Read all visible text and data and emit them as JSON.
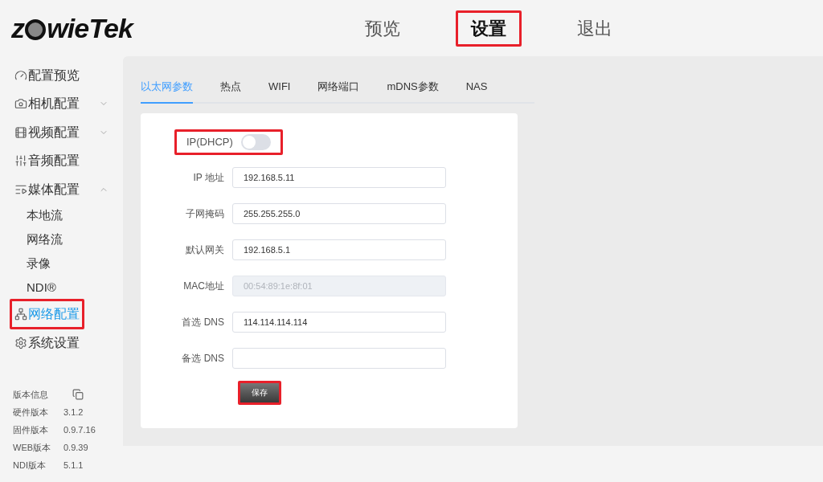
{
  "logo": {
    "before": "z",
    "after": "wieTek"
  },
  "nav": [
    {
      "label": "预览",
      "selected": false,
      "highlighted": false
    },
    {
      "label": "设置",
      "selected": true,
      "highlighted": true
    },
    {
      "label": "退出",
      "selected": false,
      "highlighted": false
    }
  ],
  "sidebar": {
    "items": [
      {
        "label": "配置预览",
        "kind": "gauge",
        "selected": false,
        "highlighted": false
      },
      {
        "label": "相机配置",
        "kind": "camera",
        "expanded": false,
        "selected": false,
        "highlighted": false
      },
      {
        "label": "视频配置",
        "kind": "film",
        "expanded": false,
        "selected": false,
        "highlighted": false
      },
      {
        "label": "音频配置",
        "kind": "sliders",
        "selected": false,
        "highlighted": false
      },
      {
        "label": "媒体配置",
        "kind": "media",
        "expanded": true,
        "selected": false,
        "highlighted": false,
        "children": [
          {
            "label": "本地流",
            "selected": false
          },
          {
            "label": "网络流",
            "selected": false
          },
          {
            "label": "录像",
            "selected": false
          },
          {
            "label": "NDI®",
            "selected": false
          }
        ]
      },
      {
        "label": "网络配置",
        "kind": "network",
        "selected": true,
        "highlighted": true
      },
      {
        "label": "系统设置",
        "kind": "gear",
        "selected": false,
        "highlighted": false
      }
    ]
  },
  "version_info": {
    "title": "版本信息",
    "rows": [
      {
        "label": "硬件版本",
        "value": "3.1.2"
      },
      {
        "label": "固件版本",
        "value": "0.9.7.16"
      },
      {
        "label": "WEB版本",
        "value": "0.9.39"
      },
      {
        "label": "NDI版本",
        "value": "5.1.1"
      }
    ]
  },
  "tabs": [
    {
      "label": "以太网参数",
      "selected": true
    },
    {
      "label": "热点",
      "selected": false
    },
    {
      "label": "WIFI",
      "selected": false
    },
    {
      "label": "网络端口",
      "selected": false
    },
    {
      "label": "mDNS参数",
      "selected": false
    },
    {
      "label": "NAS",
      "selected": false
    }
  ],
  "form": {
    "dhcp": {
      "label": "IP(DHCP)",
      "on": false,
      "highlighted": true
    },
    "fields": [
      {
        "label": "IP 地址",
        "value": "192.168.5.11",
        "disabled": false
      },
      {
        "label": "子网掩码",
        "value": "255.255.255.0",
        "disabled": false
      },
      {
        "label": "默认网关",
        "value": "192.168.5.1",
        "disabled": false
      },
      {
        "label": "MAC地址",
        "value": "00:54:89:1e:8f:01",
        "disabled": true
      },
      {
        "label": "首选 DNS",
        "value": "114.114.114.114",
        "disabled": false
      },
      {
        "label": "备选 DNS",
        "disabled": false
      }
    ],
    "save": {
      "label": "保存",
      "highlighted": true
    }
  }
}
